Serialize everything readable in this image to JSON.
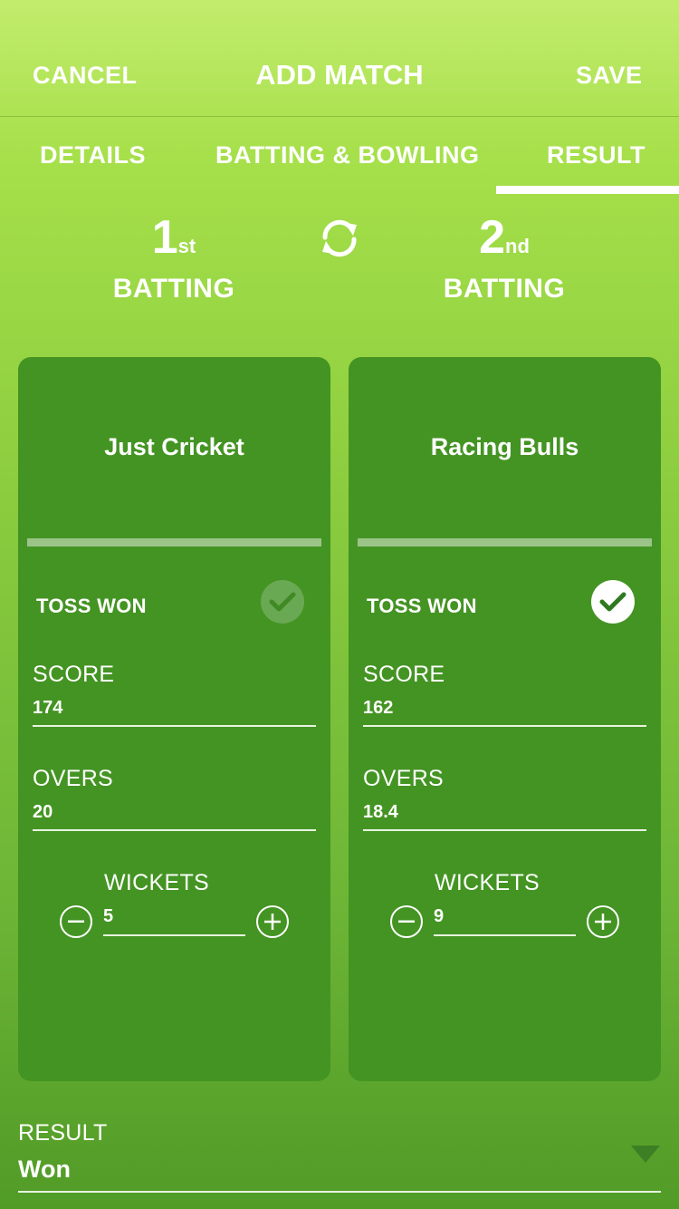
{
  "header": {
    "cancel_label": "CANCEL",
    "title": "ADD MATCH",
    "save_label": "SAVE"
  },
  "tabs": [
    {
      "label": "DETAILS",
      "active": false
    },
    {
      "label": "BATTING & BOWLING",
      "active": false
    },
    {
      "label": "RESULT",
      "active": true
    }
  ],
  "batting_order": {
    "first": {
      "number": "1",
      "suffix": "st",
      "label": "BATTING"
    },
    "second": {
      "number": "2",
      "suffix": "nd",
      "label": "BATTING"
    },
    "swap_icon": "swap-icon"
  },
  "teams": [
    {
      "name": "Just Cricket",
      "toss_label": "TOSS WON",
      "toss_won": false,
      "score_label": "SCORE",
      "score": "174",
      "overs_label": "OVERS",
      "overs": "20",
      "wickets_label": "WICKETS",
      "wickets": "5"
    },
    {
      "name": "Racing Bulls",
      "toss_label": "TOSS WON",
      "toss_won": true,
      "score_label": "SCORE",
      "score": "162",
      "overs_label": "OVERS",
      "overs": "18.4",
      "wickets_label": "WICKETS",
      "wickets": "9"
    }
  ],
  "result": {
    "label": "RESULT",
    "value": "Won"
  },
  "colors": {
    "card": "#449423",
    "accent": "#ffffff",
    "check_active": "#2f7a1e"
  }
}
